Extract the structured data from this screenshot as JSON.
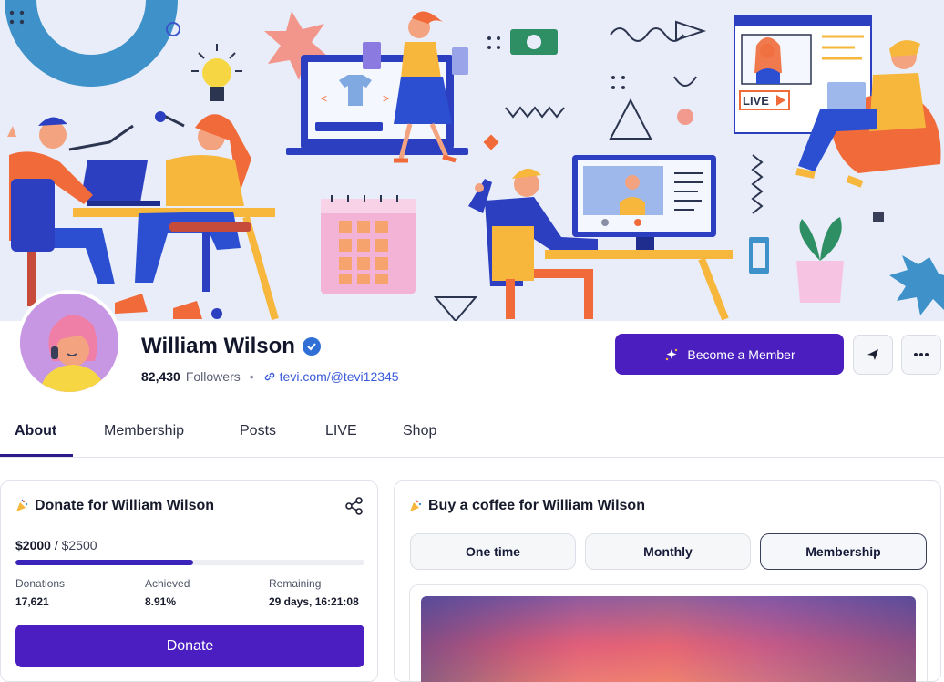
{
  "profile": {
    "name": "William Wilson",
    "followers_count": "82,430",
    "followers_label": "Followers",
    "separator": "•",
    "link": "tevi.com/@tevi12345"
  },
  "cover": {
    "live_label": "LIVE"
  },
  "actions": {
    "become_member": "Become a Member"
  },
  "tabs": [
    {
      "label": "About",
      "active": true
    },
    {
      "label": "Membership",
      "active": false
    },
    {
      "label": "Posts",
      "active": false
    },
    {
      "label": "LIVE",
      "active": false
    },
    {
      "label": "Shop",
      "active": false
    }
  ],
  "donate_card": {
    "title": "Donate for William Wilson",
    "raised": "$2000",
    "separator": "/",
    "goal": "$2500",
    "progress_fraction": 0.51,
    "stats": [
      {
        "label": "Donations",
        "value": "17,621"
      },
      {
        "label": "Achieved",
        "value": "8.91%"
      },
      {
        "label": "Remaining",
        "value": "29 days, 16:21:08"
      }
    ],
    "button": "Donate"
  },
  "coffee_card": {
    "title": "Buy a coffee for William Wilson",
    "options": [
      {
        "label": "One time",
        "selected": false
      },
      {
        "label": "Monthly",
        "selected": false
      },
      {
        "label": "Membership",
        "selected": true
      }
    ]
  },
  "colors": {
    "primary": "#4b1fbf",
    "progress": "#3923b8",
    "cover_bg": "#e9edf9",
    "verified": "#2f6fd6",
    "link": "#3a5bd9"
  },
  "icons": [
    "verified-badge-icon",
    "link-icon",
    "sparkle-icon",
    "send-icon",
    "more-icon",
    "share-icon",
    "party-icon"
  ]
}
